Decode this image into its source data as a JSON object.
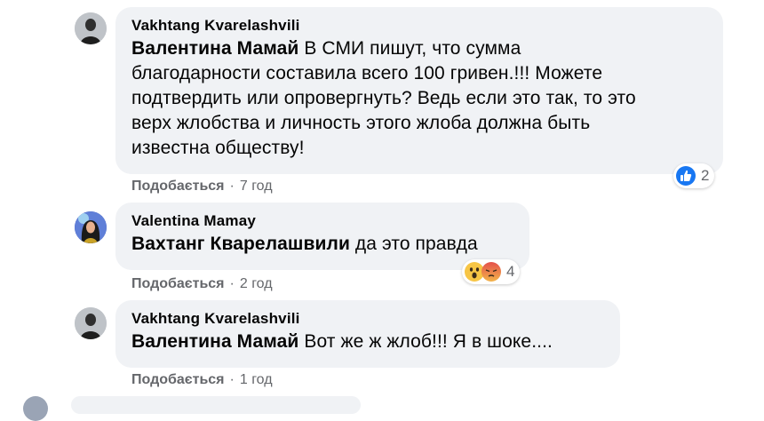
{
  "comments": [
    {
      "author": "Vakhtang Kvarelashvili",
      "mention": "Валентина Мамай",
      "text_lines": [
        " В СМИ пишут, что сумма",
        "благодарности составила всего 100 гривен.!!! Можете",
        "подтвердить или опровергнуть? Ведь если это так, то это",
        "верх жлобства и личность этого жлоба должна быть",
        "известна обществу!"
      ],
      "like_label": "Подобається",
      "separator": "·",
      "time": "7 год",
      "reactions": {
        "icons": [
          "like-icon"
        ],
        "count": "2"
      }
    },
    {
      "author": "Valentina Mamay",
      "mention": "Вахтанг Кварелашвили",
      "text_lines": [
        " да это правда"
      ],
      "like_label": "Подобається",
      "separator": "·",
      "time": "2 год",
      "reactions": {
        "icons": [
          "wow-icon",
          "angry-icon"
        ],
        "count": "4"
      }
    },
    {
      "author": "Vakhtang Kvarelashvili",
      "mention": "Валентина Мамай",
      "text_lines": [
        " Вот же ж жлоб!!! Я в шоке...."
      ],
      "like_label": "Подобається",
      "separator": "·",
      "time": "1 год"
    }
  ],
  "colors": {
    "bubble_bg": "#f0f2f5",
    "meta_text": "#65676b",
    "like_blue": "#1877f2",
    "wow_yellow": "#f7c545",
    "angry_red": "#e4504b"
  }
}
